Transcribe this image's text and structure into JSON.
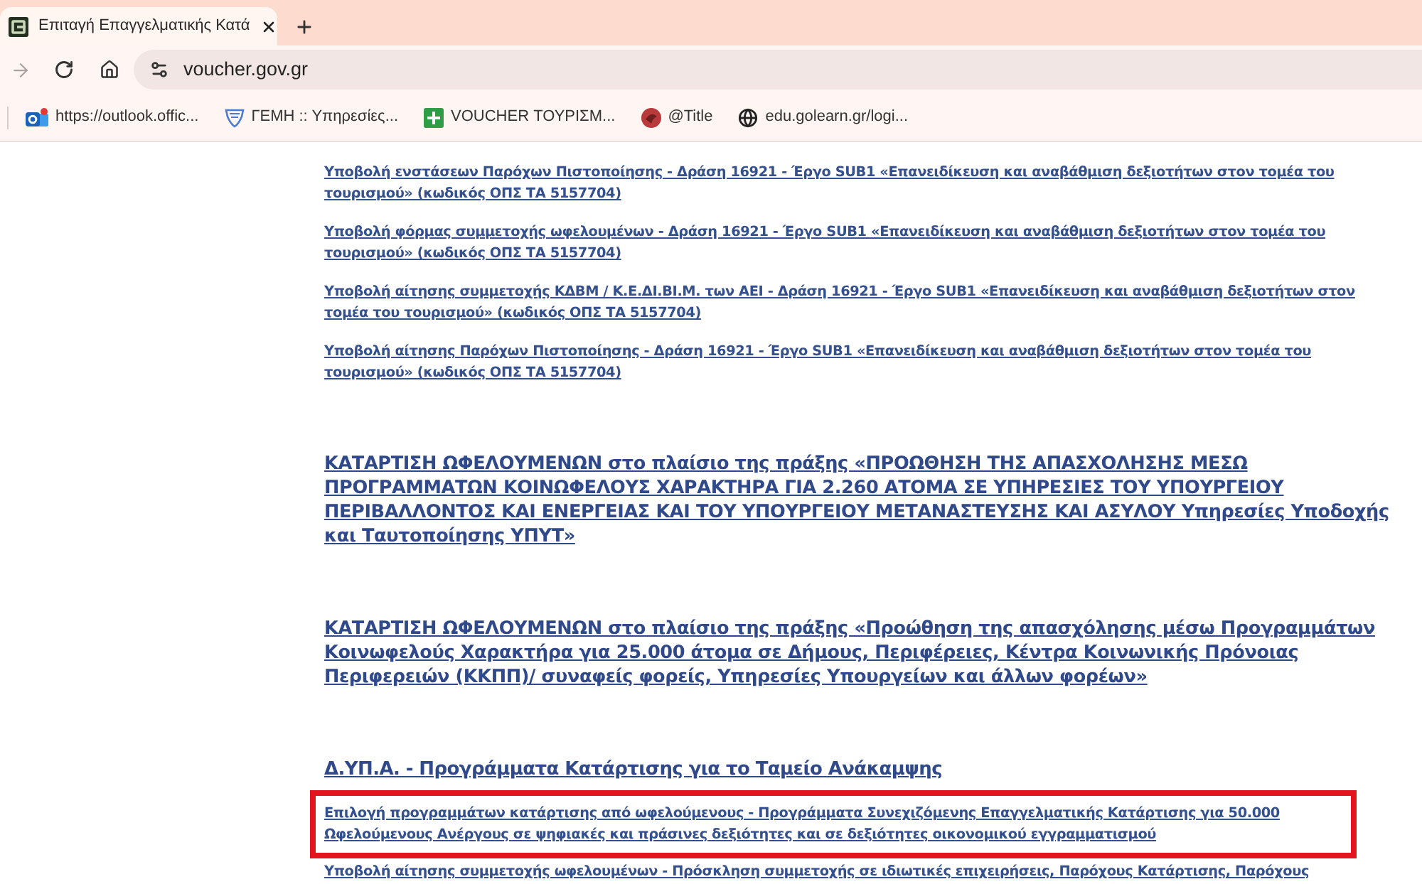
{
  "browser": {
    "tabs": [
      {
        "title": "Επιταγή Επαγγελματικής Κατά",
        "selected": true
      }
    ],
    "toolbar": {
      "forward_disabled": true
    },
    "address_bar": {
      "url": "voucher.gov.gr"
    },
    "bookmarks": [
      {
        "kind": "mail",
        "label": "https://outlook.offic..."
      },
      {
        "kind": "shield",
        "label": "ΓΕΜΗ :: Υπηρεσίες..."
      },
      {
        "kind": "plus_tile",
        "label": "VOUCHER ΤΟΥΡΙΣΜ..."
      },
      {
        "kind": "disc",
        "label": "@Title"
      },
      {
        "kind": "globe",
        "label": "edu.golearn.gr/logi..."
      }
    ]
  },
  "content": [
    {
      "kind": "link",
      "text": "Υποβολή ενστάσεων Παρόχων Πιστοποίησης - Δράση 16921 - Έργο SUB1 «Επανειδίκευση και αναβάθμιση δεξιοτήτων στον τομέα του τουρισμού» (κωδικός ΟΠΣ ΤΑ 5157704)",
      "highlighted": false
    },
    {
      "kind": "link",
      "text": "Υποβολή φόρμας συμμετοχής ωφελουμένων - Δράση 16921 - Έργο SUB1 «Επανειδίκευση και αναβάθμιση δεξιοτήτων στον τομέα του τουρισμού» (κωδικός ΟΠΣ ΤΑ 5157704)",
      "highlighted": false
    },
    {
      "kind": "link",
      "text": "Υποβολή αίτησης συμμετοχής ΚΔΒΜ / Κ.Ε.ΔΙ.ΒΙ.Μ. των ΑΕΙ - Δράση 16921 - Έργο SUB1 «Επανειδίκευση και αναβάθμιση δεξιοτήτων στον τομέα του τουρισμού» (κωδικός ΟΠΣ ΤΑ 5157704)",
      "highlighted": false
    },
    {
      "kind": "link",
      "text": "Υποβολή αίτησης Παρόχων Πιστοποίησης - Δράση 16921 - Έργο SUB1 «Επανειδίκευση και αναβάθμιση δεξιοτήτων στον τομέα του τουρισμού» (κωδικός ΟΠΣ ΤΑ 5157704)",
      "highlighted": false
    },
    {
      "kind": "heading",
      "text": "ΚΑΤΑΡΤΙΣΗ ΩΦΕΛΟΥΜΕΝΩΝ στο πλαίσιο της πράξης «ΠΡΟΩΘΗΣΗ ΤΗΣ ΑΠΑΣΧΟΛΗΣΗΣ ΜΕΣΩ ΠΡΟΓΡΑΜΜΑΤΩΝ ΚΟΙΝΩΦΕΛΟΥΣ ΧΑΡΑΚΤΗΡΑ ΓΙΑ 2.260 ΑΤΟΜΑ ΣΕ ΥΠΗΡΕΣΙΕΣ ΤΟΥ ΥΠΟΥΡΓΕΙΟΥ ΠΕΡΙΒΑΛΛΟΝΤΟΣ ΚΑΙ ΕΝΕΡΓΕΙΑΣ ΚΑΙ ΤΟΥ ΥΠΟΥΡΓΕΙΟΥ ΜΕΤΑΝΑΣΤΕΥΣΗΣ ΚΑΙ ΑΣΥΛΟΥ Υπηρεσίες Υποδοχής και Ταυτοποίησης ΥΠΥΤ»"
    },
    {
      "kind": "heading",
      "text": "ΚΑΤΑΡΤΙΣΗ ΩΦΕΛΟΥΜΕΝΩΝ στο πλαίσιο της πράξης «Προώθηση της απασχόλησης μέσω Προγραμμάτων Κοινωφελούς Χαρακτήρα για 25.000 άτομα σε Δήμους, Περιφέρειες, Κέντρα Κοινωνικής Πρόνοιας Περιφερειών (ΚΚΠΠ)/ συναφείς φορείς, Υπηρεσίες Υπουργείων και άλλων φορέων»"
    },
    {
      "kind": "section_title",
      "text": "Δ.ΥΠ.Α. - Προγράμματα Κατάρτισης για το Ταμείο Ανάκαμψης"
    },
    {
      "kind": "link",
      "text": "Επιλογή προγραμμάτων κατάρτισης από ωφελούμενους - Προγράμματα Συνεχιζόμενης Επαγγελματικής Κατάρτισης για 50.000 Ωφελούμενους Ανέργους σε ψηφιακές και πράσινες δεξιότητες και σε δεξιότητες οικονομικού εγγραμματισμού",
      "highlighted": true
    },
    {
      "kind": "link",
      "text": "Υποβολή αίτησης συμμετοχής ωφελουμένων - Πρόσκληση συμμετοχής σε ιδιωτικές επιχειρήσεις, Παρόχους Κατάρτισης, Παρόχους",
      "highlighted": false
    }
  ]
}
